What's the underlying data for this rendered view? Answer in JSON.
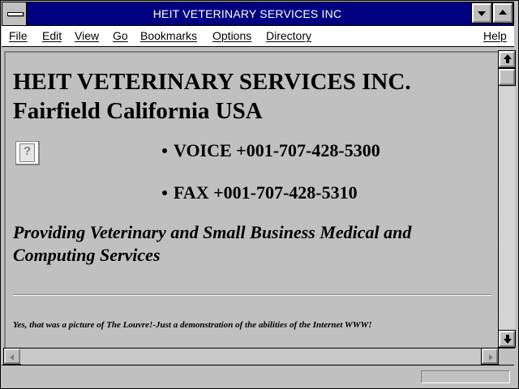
{
  "window": {
    "title": "HEIT VETERINARY SERVICES INC"
  },
  "menubar": {
    "left": [
      "File",
      "Edit",
      "View",
      "Go",
      "Bookmarks",
      "Options",
      "Directory"
    ],
    "right": "Help"
  },
  "page": {
    "heading_line1": "HEIT VETERINARY SERVICES INC.",
    "heading_line2": "Fairfield California USA",
    "image_icon": "broken-image-icon",
    "contacts": [
      "VOICE +001-707-428-5300",
      "FAX +001-707-428-5310"
    ],
    "tagline": "Providing Veterinary and Small Business Medical and Computing Services",
    "footnote": "Yes, that was a picture of The Louvre!-Just a demonstration of the abilities of the Internet WWW!"
  },
  "colors": {
    "titlebar": "#000080",
    "background": "#c0c0c0",
    "desktop": "#008080"
  }
}
